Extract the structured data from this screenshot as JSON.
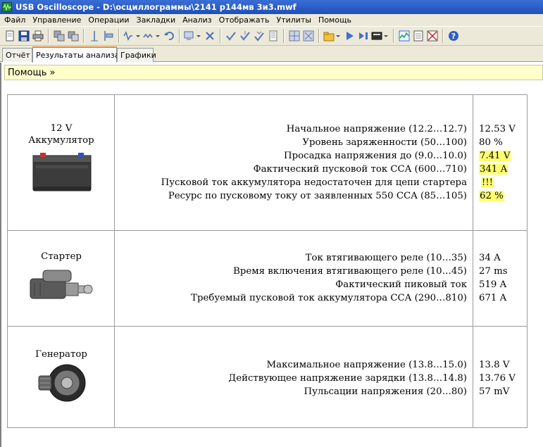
{
  "window": {
    "title": "USB Oscilloscope - D:\\осциллограммы\\2141 р144мв  3и3.mwf"
  },
  "menu": [
    "Файл",
    "Управление",
    "Операции",
    "Закладки",
    "Анализ",
    "Отображать",
    "Утилиты",
    "Помощь"
  ],
  "toolbar": {
    "icons": [
      "new-icon",
      "save-icon",
      "print-icon",
      "copy-icon",
      "paste-icon",
      "cursor-icon",
      "marker-icon",
      "waveform-icon",
      "signal-icon",
      "undo-icon",
      "zoom-icon",
      "delete-icon",
      "check-icon",
      "check-down-icon",
      "check-multi-icon",
      "document-icon",
      "grid-icon",
      "grid-x-icon",
      "open-folder-icon",
      "play-icon",
      "step-icon",
      "record-icon",
      "chart-icon",
      "table-icon",
      "no-chart-icon",
      "help-icon"
    ]
  },
  "tabs": [
    {
      "label": "Отчёт",
      "active": false
    },
    {
      "label": "Результаты анализа",
      "active": true
    },
    {
      "label": "Графики",
      "active": false
    }
  ],
  "help_bar": {
    "label": "Помощь »"
  },
  "sections": [
    {
      "name": "battery",
      "title_line1": "12 V",
      "title_line2": "Аккумулятор",
      "rows": [
        {
          "label": "Начальное напряжение (12.2…12.7)",
          "value": "12.53 V",
          "highlight": false
        },
        {
          "label": "Уровень заряженности (50…100)",
          "value": "80 %",
          "highlight": false
        },
        {
          "label": "Просадка напряжения до (9.0…10.0)",
          "value": "7.41 V",
          "highlight": true
        },
        {
          "label": "Фактический пусковой ток CCA (600…710)",
          "value": "341 A",
          "highlight": true
        },
        {
          "label": "Пусковой ток аккумулятора недостаточен для цепи стартера",
          "value": "!!!",
          "highlight": true
        },
        {
          "label": "Ресурс по пусковому току от заявленных 550 CCA (85…105)",
          "value": "62 %",
          "highlight": true
        }
      ]
    },
    {
      "name": "starter",
      "title_line1": "Стартер",
      "rows": [
        {
          "label": "Ток втягивающего реле (10…35)",
          "value": "34 A",
          "highlight": false
        },
        {
          "label": "Время включения втягивающего реле (10…45)",
          "value": "27 ms",
          "highlight": false
        },
        {
          "label": "Фактический пиковый ток",
          "value": "519 A",
          "highlight": false
        },
        {
          "label": "Требуемый пусковой ток аккумулятора CCA (290…810)",
          "value": "671 A",
          "highlight": false
        }
      ]
    },
    {
      "name": "generator",
      "title_line1": "Генератор",
      "rows": [
        {
          "label": "Максимальное напряжение (13.8…15.0)",
          "value": "13.8 V",
          "highlight": false
        },
        {
          "label": "Действующее напряжение зарядки (13.8…14.8)",
          "value": "13.76 V",
          "highlight": false
        },
        {
          "label": "Пульсации напряжения (20…80)",
          "value": "57 mV",
          "highlight": false
        }
      ]
    }
  ],
  "colors": {
    "highlight": "#ffff70",
    "title_bar": "#2455c3",
    "help_bar": "#ffffcc",
    "active_tab_accent": "#e68b2c"
  }
}
